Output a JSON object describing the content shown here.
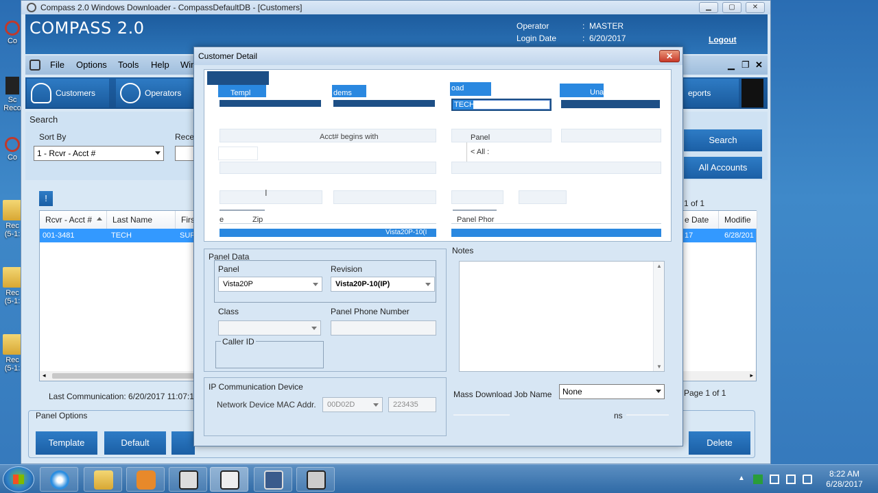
{
  "window": {
    "title": "Compass 2.0 Windows Downloader  -  CompassDefaultDB - [Customers]",
    "app_name": "COMPASS 2.0",
    "operator_label": "Operator",
    "operator_value": "MASTER",
    "login_date_label": "Login Date",
    "login_date_value": "6/20/2017",
    "colon": ":",
    "logout": "Logout"
  },
  "menu": {
    "items": [
      "File",
      "Options",
      "Tools",
      "Help",
      "Win"
    ]
  },
  "toolbar": {
    "customers": "Customers",
    "operators": "Operators",
    "reports": "eports"
  },
  "search": {
    "title": "Search",
    "sort_by_label": "Sort By",
    "sort_by_value": "1 - Rcvr - Acct #",
    "rcvr_label": "Recei",
    "search_button": "Search",
    "all_accounts_button": "All Accounts",
    "alert_glyph": "!",
    "paging": "d 1 of 1"
  },
  "grid": {
    "columns": [
      "Rcvr - Acct #",
      "Last Name",
      "Firs",
      "e Date",
      "Modifie"
    ],
    "rows": [
      {
        "acct": "001-3481",
        "last": "TECH",
        "first": "SUP",
        "date": "17",
        "modified": "6/28/201"
      }
    ],
    "footer_paging": "Page 1 of 1"
  },
  "status": {
    "last_communication": "Last Communication: 6/20/2017 11:07:14"
  },
  "panel_options": {
    "title": "Panel Options",
    "template": "Template",
    "default": "Default",
    "delete": "Delete"
  },
  "dialog": {
    "title": "Customer Detail",
    "close": "✕",
    "ghost": {
      "templ": "Templ",
      "modems": "dems",
      "load": "oad",
      "una": "Una",
      "tech_field": "TECH",
      "acct_begins": "Acct# begins with",
      "panel": "Panel",
      "all": "< All :",
      "zip_prefix": "e",
      "zip": "Zip",
      "panel_phone": "Panel Phor",
      "vista_row": "Vista20P-10(I"
    },
    "panel_data": {
      "title": "Panel Data",
      "panel_label": "Panel",
      "panel_value": "Vista20P",
      "revision_label": "Revision",
      "revision_value": "Vista20P-10(IP)",
      "class_label": "Class",
      "class_value": "",
      "phone_label": "Panel Phone Number",
      "phone_value": "",
      "caller_id_label": "Caller ID"
    },
    "notes": {
      "title": "Notes",
      "value": ""
    },
    "ip": {
      "title": "IP Communication Device",
      "mac_label": "Network Device MAC Addr.",
      "mac_prefix": "00D02D",
      "mac_suffix": "223435"
    },
    "mass_download": {
      "label": "Mass Download Job Name",
      "value": "None"
    },
    "ghost_ns": "ns"
  },
  "desktop": {
    "icons": [
      "Co",
      "Sc Reco",
      "Co",
      "Rec (5-1:",
      "Rec (5-1:",
      "Rec (5-1:"
    ]
  },
  "taskbar": {
    "time": "8:22 AM",
    "date": "6/28/2017"
  }
}
